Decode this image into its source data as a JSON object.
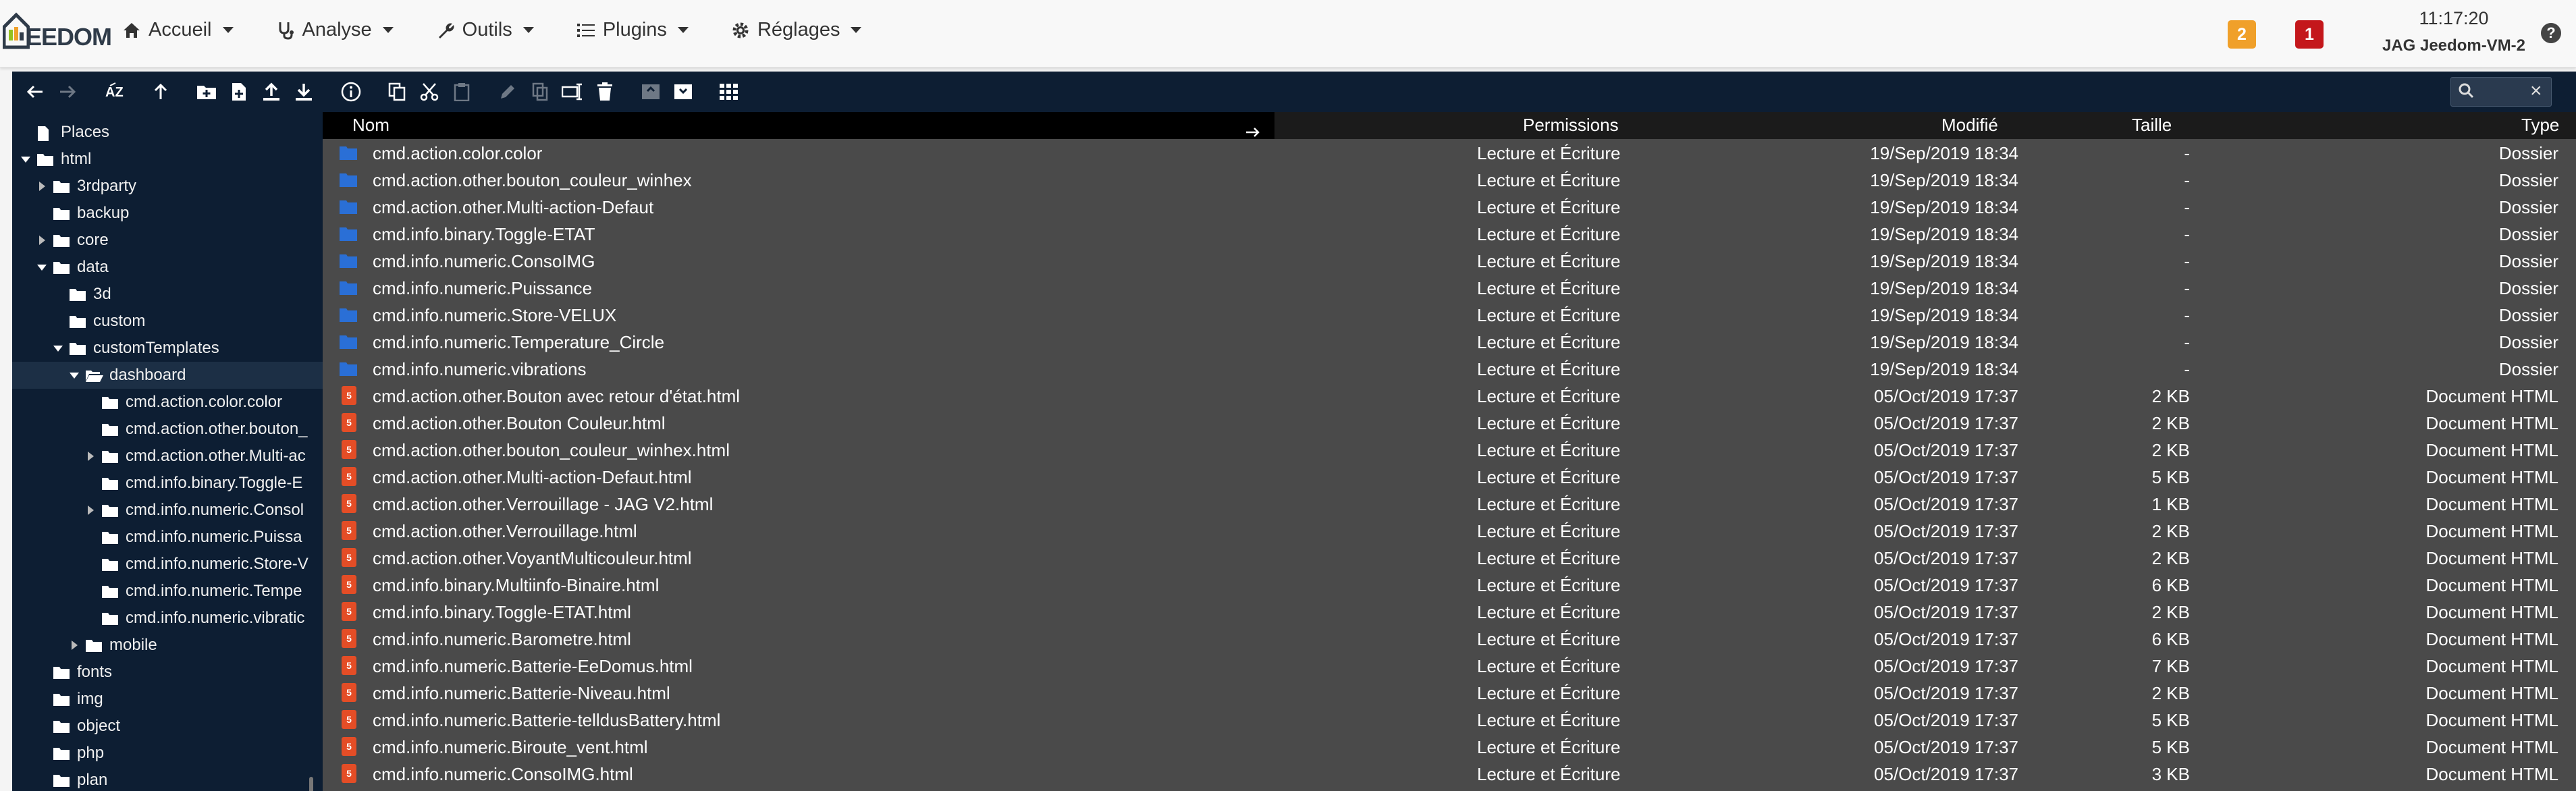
{
  "app": {
    "logo_text": "EEDOM",
    "menu": [
      {
        "label": "Accueil",
        "icon": "home-icon"
      },
      {
        "label": "Analyse",
        "icon": "stethoscope-icon"
      },
      {
        "label": "Outils",
        "icon": "wrench-icon"
      },
      {
        "label": "Plugins",
        "icon": "list-icon"
      },
      {
        "label": "Réglages",
        "icon": "gear-icon"
      }
    ],
    "badges": {
      "orange": "2",
      "red": "1"
    },
    "clock": "11:17:20",
    "hostname": "JAG Jeedom-VM-2",
    "help_label": "?"
  },
  "colors": {
    "toolbar_bg": "#0d1e33",
    "list_bg": "#4a4a4a",
    "folder_blue": "#2a6fd6",
    "html_orange": "#e44d26",
    "badge_orange": "#f0a02a",
    "badge_red": "#c4171b"
  },
  "toolbar": {
    "search_placeholder": "",
    "icons": [
      "back-arrow-icon",
      "forward-arrow-icon",
      "sort-az-icon",
      "up-arrow-icon",
      "new-folder-icon",
      "new-file-icon",
      "upload-icon",
      "download-icon",
      "info-icon",
      "copy-icon",
      "cut-icon",
      "paste-icon",
      "edit-icon",
      "duplicate-icon",
      "rename-icon",
      "delete-icon",
      "archive-icon",
      "extract-icon",
      "grid-view-icon",
      "search-icon",
      "close-icon"
    ]
  },
  "tree": [
    {
      "label": "Places",
      "level": 0,
      "toggle": "none",
      "icon": "places-icon"
    },
    {
      "label": "html",
      "level": 0,
      "toggle": "open",
      "icon": "folder-icon"
    },
    {
      "label": "3rdparty",
      "level": 1,
      "toggle": "closed",
      "icon": "folder-icon"
    },
    {
      "label": "backup",
      "level": 1,
      "toggle": "none",
      "icon": "folder-icon"
    },
    {
      "label": "core",
      "level": 1,
      "toggle": "closed",
      "icon": "folder-icon"
    },
    {
      "label": "data",
      "level": 1,
      "toggle": "open",
      "icon": "folder-icon"
    },
    {
      "label": "3d",
      "level": 2,
      "toggle": "none",
      "icon": "folder-icon"
    },
    {
      "label": "custom",
      "level": 2,
      "toggle": "none",
      "icon": "folder-icon"
    },
    {
      "label": "customTemplates",
      "level": 2,
      "toggle": "open",
      "icon": "folder-icon"
    },
    {
      "label": "dashboard",
      "level": 3,
      "toggle": "open",
      "icon": "open-folder-icon",
      "selected": true
    },
    {
      "label": "cmd.action.color.color",
      "level": 4,
      "toggle": "none",
      "icon": "folder-icon"
    },
    {
      "label": "cmd.action.other.bouton_",
      "level": 4,
      "toggle": "none",
      "icon": "folder-icon"
    },
    {
      "label": "cmd.action.other.Multi-ac",
      "level": 4,
      "toggle": "closed",
      "icon": "folder-icon"
    },
    {
      "label": "cmd.info.binary.Toggle-E",
      "level": 4,
      "toggle": "none",
      "icon": "folder-icon"
    },
    {
      "label": "cmd.info.numeric.Consol",
      "level": 4,
      "toggle": "closed",
      "icon": "folder-icon"
    },
    {
      "label": "cmd.info.numeric.Puissa",
      "level": 4,
      "toggle": "none",
      "icon": "folder-icon"
    },
    {
      "label": "cmd.info.numeric.Store-V",
      "level": 4,
      "toggle": "none",
      "icon": "folder-icon"
    },
    {
      "label": "cmd.info.numeric.Tempe",
      "level": 4,
      "toggle": "none",
      "icon": "folder-icon"
    },
    {
      "label": "cmd.info.numeric.vibratic",
      "level": 4,
      "toggle": "none",
      "icon": "folder-icon"
    },
    {
      "label": "mobile",
      "level": 3,
      "toggle": "closed",
      "icon": "folder-icon"
    },
    {
      "label": "fonts",
      "level": 1,
      "toggle": "none",
      "icon": "folder-icon"
    },
    {
      "label": "img",
      "level": 1,
      "toggle": "none",
      "icon": "folder-icon"
    },
    {
      "label": "object",
      "level": 1,
      "toggle": "none",
      "icon": "folder-icon"
    },
    {
      "label": "php",
      "level": 1,
      "toggle": "none",
      "icon": "folder-icon"
    },
    {
      "label": "plan",
      "level": 1,
      "toggle": "none",
      "icon": "folder-icon"
    }
  ],
  "list": {
    "columns": {
      "name": "Nom",
      "permissions": "Permissions",
      "modified": "Modifié",
      "size": "Taille",
      "type": "Type"
    },
    "rows": [
      {
        "name": "cmd.action.color.color",
        "perm": "Lecture et Écriture",
        "modified": "19/Sep/2019 18:34",
        "size": "-",
        "type": "Dossier",
        "kind": "folder"
      },
      {
        "name": "cmd.action.other.bouton_couleur_winhex",
        "perm": "Lecture et Écriture",
        "modified": "19/Sep/2019 18:34",
        "size": "-",
        "type": "Dossier",
        "kind": "folder"
      },
      {
        "name": "cmd.action.other.Multi-action-Defaut",
        "perm": "Lecture et Écriture",
        "modified": "19/Sep/2019 18:34",
        "size": "-",
        "type": "Dossier",
        "kind": "folder"
      },
      {
        "name": "cmd.info.binary.Toggle-ETAT",
        "perm": "Lecture et Écriture",
        "modified": "19/Sep/2019 18:34",
        "size": "-",
        "type": "Dossier",
        "kind": "folder"
      },
      {
        "name": "cmd.info.numeric.ConsoIMG",
        "perm": "Lecture et Écriture",
        "modified": "19/Sep/2019 18:34",
        "size": "-",
        "type": "Dossier",
        "kind": "folder"
      },
      {
        "name": "cmd.info.numeric.Puissance",
        "perm": "Lecture et Écriture",
        "modified": "19/Sep/2019 18:34",
        "size": "-",
        "type": "Dossier",
        "kind": "folder"
      },
      {
        "name": "cmd.info.numeric.Store-VELUX",
        "perm": "Lecture et Écriture",
        "modified": "19/Sep/2019 18:34",
        "size": "-",
        "type": "Dossier",
        "kind": "folder"
      },
      {
        "name": "cmd.info.numeric.Temperature_Circle",
        "perm": "Lecture et Écriture",
        "modified": "19/Sep/2019 18:34",
        "size": "-",
        "type": "Dossier",
        "kind": "folder"
      },
      {
        "name": "cmd.info.numeric.vibrations",
        "perm": "Lecture et Écriture",
        "modified": "19/Sep/2019 18:34",
        "size": "-",
        "type": "Dossier",
        "kind": "folder"
      },
      {
        "name": "cmd.action.other.Bouton avec retour d'état.html",
        "perm": "Lecture et Écriture",
        "modified": "05/Oct/2019 17:37",
        "size": "2 KB",
        "type": "Document HTML",
        "kind": "html"
      },
      {
        "name": "cmd.action.other.Bouton Couleur.html",
        "perm": "Lecture et Écriture",
        "modified": "05/Oct/2019 17:37",
        "size": "2 KB",
        "type": "Document HTML",
        "kind": "html"
      },
      {
        "name": "cmd.action.other.bouton_couleur_winhex.html",
        "perm": "Lecture et Écriture",
        "modified": "05/Oct/2019 17:37",
        "size": "2 KB",
        "type": "Document HTML",
        "kind": "html"
      },
      {
        "name": "cmd.action.other.Multi-action-Defaut.html",
        "perm": "Lecture et Écriture",
        "modified": "05/Oct/2019 17:37",
        "size": "5 KB",
        "type": "Document HTML",
        "kind": "html"
      },
      {
        "name": "cmd.action.other.Verrouillage - JAG V2.html",
        "perm": "Lecture et Écriture",
        "modified": "05/Oct/2019 17:37",
        "size": "1 KB",
        "type": "Document HTML",
        "kind": "html"
      },
      {
        "name": "cmd.action.other.Verrouillage.html",
        "perm": "Lecture et Écriture",
        "modified": "05/Oct/2019 17:37",
        "size": "2 KB",
        "type": "Document HTML",
        "kind": "html"
      },
      {
        "name": "cmd.action.other.VoyantMulticouleur.html",
        "perm": "Lecture et Écriture",
        "modified": "05/Oct/2019 17:37",
        "size": "2 KB",
        "type": "Document HTML",
        "kind": "html"
      },
      {
        "name": "cmd.info.binary.Multiinfo-Binaire.html",
        "perm": "Lecture et Écriture",
        "modified": "05/Oct/2019 17:37",
        "size": "6 KB",
        "type": "Document HTML",
        "kind": "html"
      },
      {
        "name": "cmd.info.binary.Toggle-ETAT.html",
        "perm": "Lecture et Écriture",
        "modified": "05/Oct/2019 17:37",
        "size": "2 KB",
        "type": "Document HTML",
        "kind": "html"
      },
      {
        "name": "cmd.info.numeric.Barometre.html",
        "perm": "Lecture et Écriture",
        "modified": "05/Oct/2019 17:37",
        "size": "6 KB",
        "type": "Document HTML",
        "kind": "html"
      },
      {
        "name": "cmd.info.numeric.Batterie-EeDomus.html",
        "perm": "Lecture et Écriture",
        "modified": "05/Oct/2019 17:37",
        "size": "7 KB",
        "type": "Document HTML",
        "kind": "html"
      },
      {
        "name": "cmd.info.numeric.Batterie-Niveau.html",
        "perm": "Lecture et Écriture",
        "modified": "05/Oct/2019 17:37",
        "size": "2 KB",
        "type": "Document HTML",
        "kind": "html"
      },
      {
        "name": "cmd.info.numeric.Batterie-telldusBattery.html",
        "perm": "Lecture et Écriture",
        "modified": "05/Oct/2019 17:37",
        "size": "5 KB",
        "type": "Document HTML",
        "kind": "html"
      },
      {
        "name": "cmd.info.numeric.Biroute_vent.html",
        "perm": "Lecture et Écriture",
        "modified": "05/Oct/2019 17:37",
        "size": "5 KB",
        "type": "Document HTML",
        "kind": "html"
      },
      {
        "name": "cmd.info.numeric.ConsoIMG.html",
        "perm": "Lecture et Écriture",
        "modified": "05/Oct/2019 17:37",
        "size": "3 KB",
        "type": "Document HTML",
        "kind": "html"
      }
    ]
  }
}
